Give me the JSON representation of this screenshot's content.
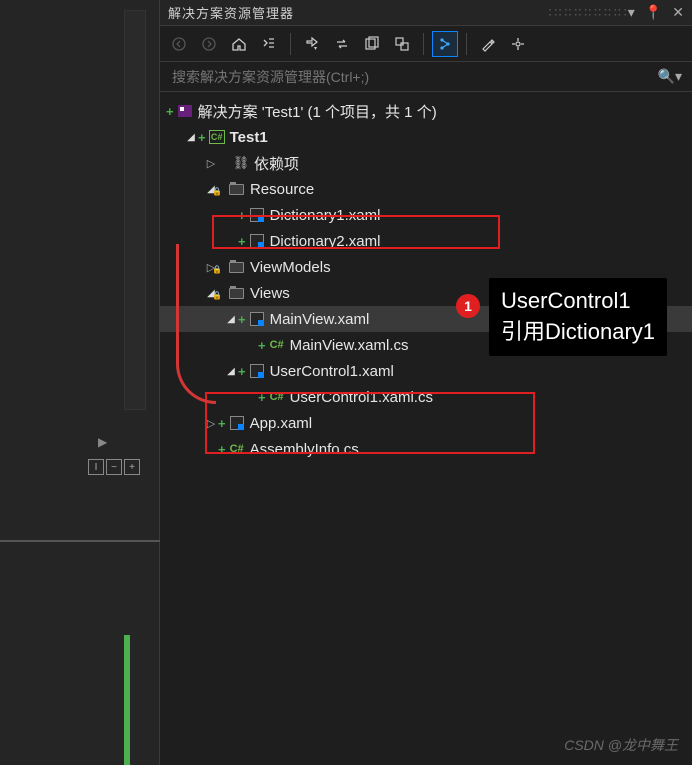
{
  "panel": {
    "title": "解决方案资源管理器",
    "search_placeholder": "搜索解决方案资源管理器(Ctrl+;)"
  },
  "tree": {
    "solution": "解决方案 'Test1' (1 个项目，共 1 个)",
    "project": "Test1",
    "dependencies": "依赖项",
    "resource": "Resource",
    "dict1": "Dictionary1.xaml",
    "dict2": "Dictionary2.xaml",
    "viewmodels": "ViewModels",
    "views": "Views",
    "mainview": "MainView.xaml",
    "mainview_cs": "MainView.xaml.cs",
    "usercontrol1": "UserControl1.xaml",
    "usercontrol1_cs": "UserControl1.xaml.cs",
    "app": "App.xaml",
    "assemblyinfo": "AssemblyInfo.cs",
    "cs_label": "C#"
  },
  "annotation": {
    "badge": "1",
    "line1": "UserControl1",
    "line2": "引用Dictionary1"
  },
  "watermark": "CSDN @龙中舞王",
  "gutter": {
    "tool1": "I",
    "tool2": "−",
    "tool3": "+"
  }
}
